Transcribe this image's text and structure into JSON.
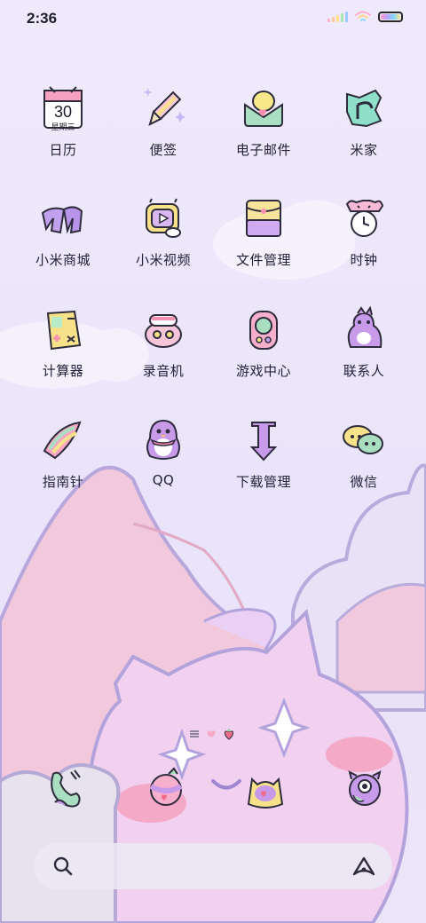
{
  "status_bar": {
    "time": "2:36"
  },
  "apps": [
    {
      "name": "app-calendar",
      "label": "日历",
      "icon": "calendar-icon",
      "calendar_day": "30",
      "calendar_weekday": "星期三"
    },
    {
      "name": "app-notes",
      "label": "便签",
      "icon": "pencil-icon"
    },
    {
      "name": "app-email",
      "label": "电子邮件",
      "icon": "envelope-icon"
    },
    {
      "name": "app-mijia",
      "label": "米家",
      "icon": "mijia-icon"
    },
    {
      "name": "app-mi-store",
      "label": "小米商城",
      "icon": "mi-logo-icon"
    },
    {
      "name": "app-mi-video",
      "label": "小米视频",
      "icon": "tv-icon"
    },
    {
      "name": "app-file-manager",
      "label": "文件管理",
      "icon": "folder-icon"
    },
    {
      "name": "app-clock",
      "label": "时钟",
      "icon": "alarm-clock-icon"
    },
    {
      "name": "app-calculator",
      "label": "计算器",
      "icon": "calculator-icon"
    },
    {
      "name": "app-recorder",
      "label": "录音机",
      "icon": "recorder-icon"
    },
    {
      "name": "app-game-center",
      "label": "游戏中心",
      "icon": "gamepad-icon"
    },
    {
      "name": "app-contacts",
      "label": "联系人",
      "icon": "dinosaur-icon"
    },
    {
      "name": "app-compass",
      "label": "指南针",
      "icon": "compass-icon"
    },
    {
      "name": "app-qq",
      "label": "QQ",
      "icon": "penguin-icon"
    },
    {
      "name": "app-download-manager",
      "label": "下载管理",
      "icon": "download-arrow-icon"
    },
    {
      "name": "app-wechat",
      "label": "微信",
      "icon": "chat-bubbles-icon"
    }
  ],
  "dock": [
    {
      "name": "dock-phone",
      "icon": "phone-icon"
    },
    {
      "name": "dock-messages",
      "icon": "message-ball-icon"
    },
    {
      "name": "dock-browser",
      "icon": "cat-browser-icon"
    },
    {
      "name": "dock-camera",
      "icon": "monster-camera-icon"
    }
  ],
  "dock_indicator": {
    "icons": [
      "menu-lines-icon",
      "heart-icon",
      "strawberry-icon"
    ]
  },
  "search": {
    "icon": "search-icon",
    "assistant_icon": "assistant-a-icon"
  }
}
